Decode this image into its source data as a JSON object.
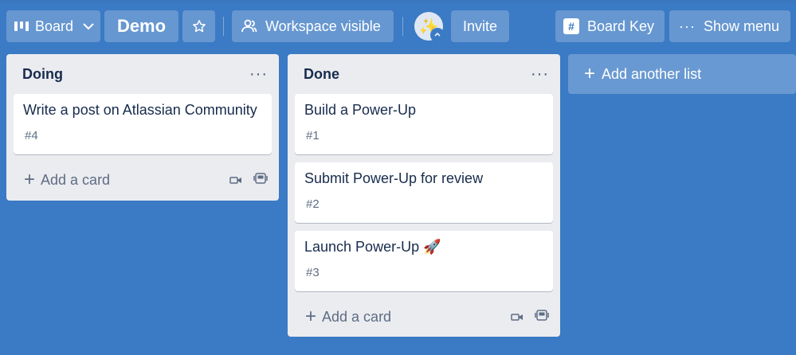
{
  "header": {
    "board_label": "Board",
    "board_title": "Demo",
    "visibility_label": "Workspace visible",
    "invite_label": "Invite",
    "board_key_label": "Board Key",
    "show_menu_label": "Show menu",
    "avatar_emoji": "✨"
  },
  "lists": [
    {
      "title": "Doing",
      "cards": [
        {
          "title": "Write a post on Atlassian Community",
          "number": "#4"
        }
      ],
      "add_card_label": "Add a card"
    },
    {
      "title": "Done",
      "cards": [
        {
          "title": "Build a Power-Up",
          "number": "#1"
        },
        {
          "title": "Submit Power-Up for review",
          "number": "#2"
        },
        {
          "title": "Launch Power-Up 🚀",
          "number": "#3"
        }
      ],
      "add_card_label": "Add a card"
    }
  ],
  "add_list_label": "Add another list",
  "colors": {
    "board_bg": "#3b7ac4",
    "list_bg": "#ebecf0",
    "card_bg": "#ffffff",
    "text_dark": "#172b4d",
    "text_muted": "#5e6c84"
  }
}
